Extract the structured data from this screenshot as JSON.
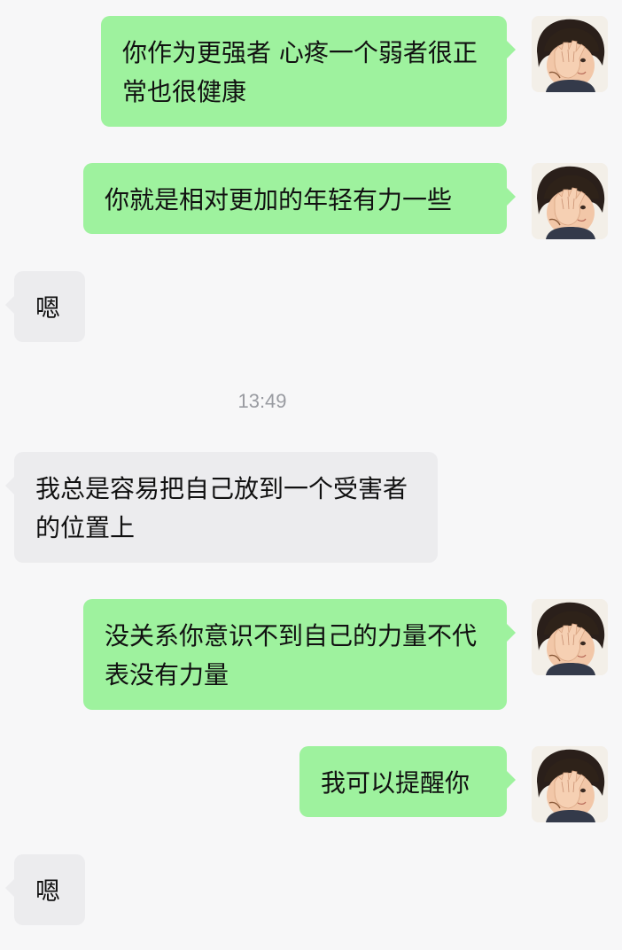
{
  "messages": [
    {
      "id": 1,
      "side": "out",
      "text": "你作为更强者 心疼一个弱者很正常也很健康"
    },
    {
      "id": 2,
      "side": "out",
      "text": "你就是相对更加的年轻有力一些"
    },
    {
      "id": 3,
      "side": "in",
      "text": "嗯"
    },
    {
      "id": 4,
      "side": "in",
      "text": "我总是容易把自己放到一个受害者的位置上"
    },
    {
      "id": 5,
      "side": "out",
      "text": "没关系你意识不到自己的力量不代表没有力量"
    },
    {
      "id": 6,
      "side": "out",
      "text": "我可以提醒你"
    },
    {
      "id": 7,
      "side": "in",
      "text": "嗯"
    }
  ],
  "timestamp": "13:49",
  "colors": {
    "outgoing_bubble": "#9ef29e",
    "incoming_bubble": "#ececee",
    "background": "#f7f7f8",
    "timestamp_text": "#999ba1"
  },
  "icons": {
    "self_avatar": "child-covering-face-avatar"
  }
}
